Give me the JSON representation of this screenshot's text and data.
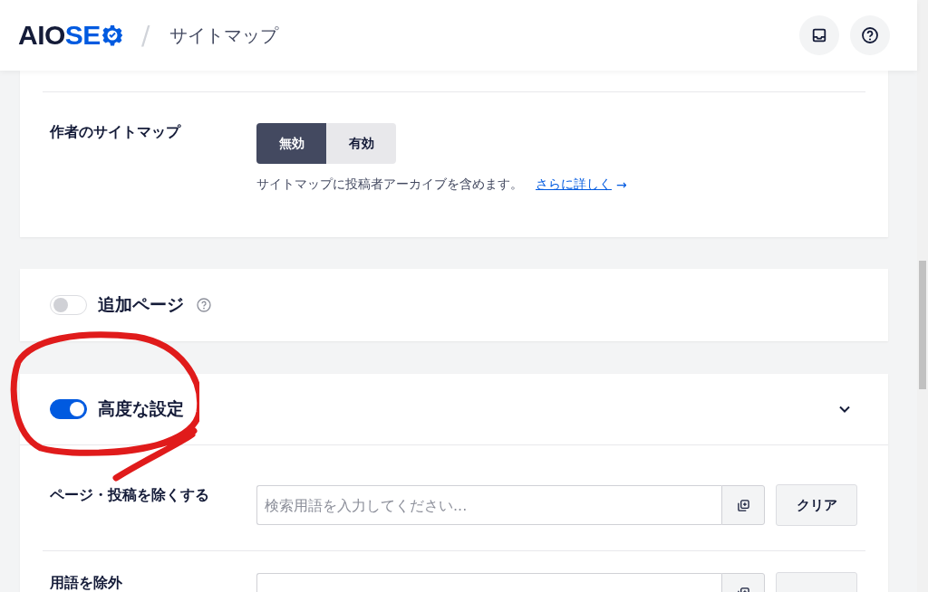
{
  "header": {
    "logo": {
      "dark": "AIO",
      "accent": "SE"
    },
    "separator": "/",
    "page_title": "サイトマップ"
  },
  "author_sitemap": {
    "label": "作者のサイトマップ",
    "options": [
      {
        "label": "無効",
        "selected": true
      },
      {
        "label": "有効",
        "selected": false
      }
    ],
    "description": "サイトマップに投稿者アーカイブを含めます。",
    "link": "さらに詳しく",
    "link_arrow": "→"
  },
  "additional_pages": {
    "on": false,
    "label": "追加ページ"
  },
  "advanced": {
    "on": true,
    "label": "高度な設定",
    "expanded": true,
    "rows": [
      {
        "label": "ページ・投稿を除くする",
        "placeholder": "検索用語を入力してください...",
        "button": "クリア"
      },
      {
        "label": "用語を除外"
      }
    ]
  }
}
